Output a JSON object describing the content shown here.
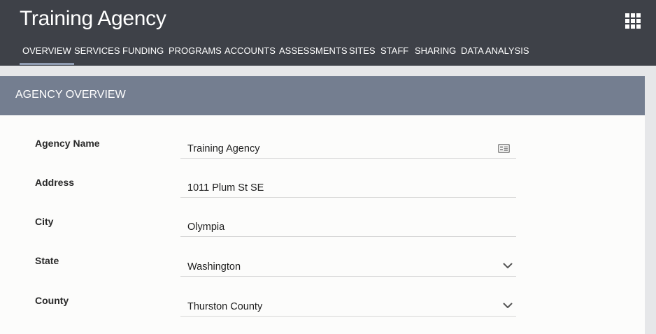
{
  "app": {
    "title": "Training Agency"
  },
  "nav": {
    "tabs": [
      {
        "label": "OVERVIEW"
      },
      {
        "label": "SERVICES"
      },
      {
        "label": "FUNDING"
      },
      {
        "label": "PROGRAMS"
      },
      {
        "label": "ACCOUNTS"
      },
      {
        "label": "ASSESSMENTS"
      },
      {
        "label": "SITES"
      },
      {
        "label": "STAFF"
      },
      {
        "label": "SHARING"
      },
      {
        "label": "DATA ANALYSIS"
      }
    ],
    "active": "OVERVIEW"
  },
  "panel": {
    "title": "AGENCY OVERVIEW"
  },
  "form": {
    "agency_name": {
      "label": "Agency Name",
      "value": "Training Agency"
    },
    "address": {
      "label": "Address",
      "value": "1011 Plum St SE"
    },
    "city": {
      "label": "City",
      "value": "Olympia"
    },
    "state": {
      "label": "State",
      "value": "Washington"
    },
    "county": {
      "label": "County",
      "value": "Thurston County"
    }
  },
  "icons": {
    "apps": "grid-apps-icon",
    "agency_name": "id-card-icon",
    "dropdown": "chevron-down-icon"
  },
  "colors": {
    "topbar": "#3e4148",
    "panel_header": "#747e90",
    "active_tab_underline": "#8f9bb1"
  }
}
